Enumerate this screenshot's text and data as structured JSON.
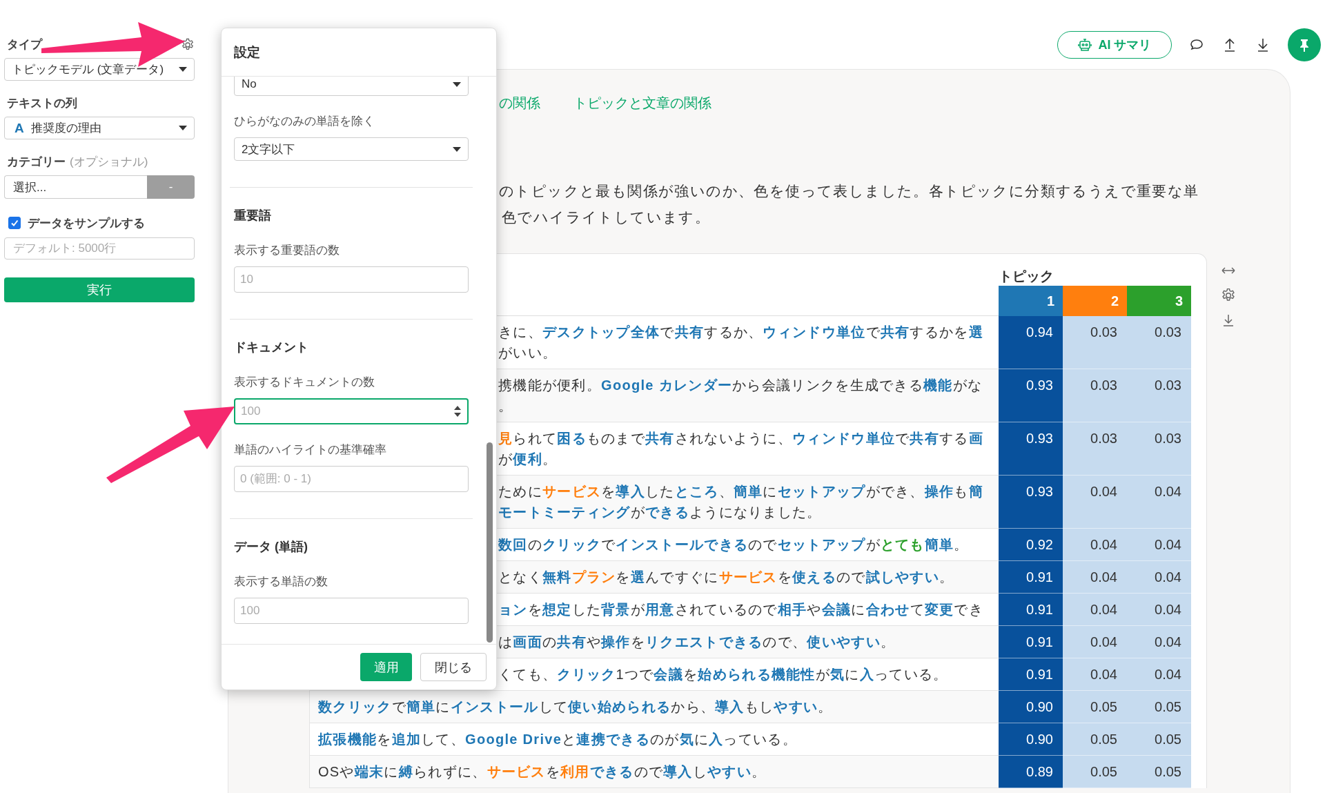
{
  "sidebar": {
    "type_label": "タイプ",
    "type_value": "トピックモデル (文章データ)",
    "text_column_label": "テキストの列",
    "text_column_type": "A",
    "text_column_value": "推奨度の理由",
    "category_label": "カテゴリー",
    "category_optional": "(オプショナル)",
    "category_value": "選択...",
    "category_button": "-",
    "sample": {
      "label": "データをサンプルする",
      "checked": true
    },
    "sample_placeholder": "デフォルト: 5000行",
    "run_button": "実行"
  },
  "toolbar": {
    "ai_button": "AI サマリ"
  },
  "tabs": [
    {
      "label": "の関係"
    },
    {
      "label": "トピックと文章の関係"
    }
  ],
  "description": [
    "のトピックと最も関係が強いのか、色を使って表しました。各トピックに分類するうえで重要な単",
    "色でハイライトしています。"
  ],
  "table": {
    "heading": "トピック",
    "topics": [
      {
        "label": "1",
        "color": "#1f77b4"
      },
      {
        "label": "2",
        "color": "#ff7f0e"
      },
      {
        "label": "3",
        "color": "#2ca02c"
      }
    ],
    "rows": [
      {
        "covered": true,
        "lines": [
          [
            {
              "text": "きに、"
            },
            {
              "text": "デスクトップ全体",
              "color": "#1f77b4"
            },
            {
              "text": "で"
            },
            {
              "text": "共有",
              "color": "#1f77b4"
            },
            {
              "text": "するか、"
            },
            {
              "text": "ウィンドウ単位",
              "color": "#1f77b4"
            },
            {
              "text": "で"
            },
            {
              "text": "共有",
              "color": "#1f77b4"
            },
            {
              "text": "するかを"
            },
            {
              "text": "選",
              "color": "#1f77b4"
            }
          ],
          [
            {
              "text": "がいい。"
            }
          ]
        ],
        "scores": [
          "0.94",
          "0.03",
          "0.03"
        ]
      },
      {
        "covered": true,
        "lines": [
          [
            {
              "text": "携機能が便利。"
            },
            {
              "text": "Google カレンダー",
              "color": "#1f77b4"
            },
            {
              "text": "から会議リンクを生成できる"
            },
            {
              "text": "機能",
              "color": "#1f77b4"
            },
            {
              "text": "がな"
            }
          ],
          [
            {
              "text": "。"
            }
          ]
        ],
        "scores": [
          "0.93",
          "0.03",
          "0.03"
        ]
      },
      {
        "covered": true,
        "lines": [
          [
            {
              "text": "見",
              "color": "#ff7f0e"
            },
            {
              "text": "られて"
            },
            {
              "text": "困る",
              "color": "#1f77b4"
            },
            {
              "text": "ものまで"
            },
            {
              "text": "共有",
              "color": "#1f77b4"
            },
            {
              "text": "されないように、"
            },
            {
              "text": "ウィンドウ単位",
              "color": "#1f77b4"
            },
            {
              "text": "で"
            },
            {
              "text": "共有",
              "color": "#1f77b4"
            },
            {
              "text": "する"
            },
            {
              "text": "画",
              "color": "#1f77b4"
            }
          ],
          [
            {
              "text": "が"
            },
            {
              "text": "便利",
              "color": "#1f77b4"
            },
            {
              "text": "。"
            }
          ]
        ],
        "scores": [
          "0.93",
          "0.03",
          "0.03"
        ]
      },
      {
        "covered": true,
        "lines": [
          [
            {
              "text": "ために"
            },
            {
              "text": "サービス",
              "color": "#ff7f0e"
            },
            {
              "text": "を"
            },
            {
              "text": "導入",
              "color": "#1f77b4"
            },
            {
              "text": "した"
            },
            {
              "text": "ところ",
              "color": "#1f77b4"
            },
            {
              "text": "、"
            },
            {
              "text": "簡単",
              "color": "#1f77b4"
            },
            {
              "text": "に"
            },
            {
              "text": "セットアップ",
              "color": "#1f77b4"
            },
            {
              "text": "ができ、"
            },
            {
              "text": "操作",
              "color": "#1f77b4"
            },
            {
              "text": "も"
            },
            {
              "text": "簡",
              "color": "#1f77b4"
            }
          ],
          [
            {
              "text": "モートミーティング",
              "color": "#1f77b4"
            },
            {
              "text": "が"
            },
            {
              "text": "できる",
              "color": "#1f77b4"
            },
            {
              "text": "ようになりました。"
            }
          ]
        ],
        "scores": [
          "0.93",
          "0.04",
          "0.04"
        ]
      },
      {
        "covered": true,
        "lines": [
          [
            {
              "text": "数回",
              "color": "#1f77b4"
            },
            {
              "text": "の"
            },
            {
              "text": "クリック",
              "color": "#1f77b4"
            },
            {
              "text": "で"
            },
            {
              "text": "インストールできる",
              "color": "#1f77b4"
            },
            {
              "text": "ので"
            },
            {
              "text": "セットアップ",
              "color": "#1f77b4"
            },
            {
              "text": "が"
            },
            {
              "text": "とても",
              "color": "#2ca02c"
            },
            {
              "text": "簡単",
              "color": "#1f77b4"
            },
            {
              "text": "。"
            }
          ]
        ],
        "scores": [
          "0.92",
          "0.04",
          "0.04"
        ]
      },
      {
        "covered": true,
        "lines": [
          [
            {
              "text": "となく"
            },
            {
              "text": "無料",
              "color": "#1f77b4"
            },
            {
              "text": "プラン",
              "color": "#ff7f0e"
            },
            {
              "text": "を"
            },
            {
              "text": "選",
              "color": "#1f77b4"
            },
            {
              "text": "んですぐに"
            },
            {
              "text": "サービス",
              "color": "#ff7f0e"
            },
            {
              "text": "を"
            },
            {
              "text": "使える",
              "color": "#1f77b4"
            },
            {
              "text": "ので"
            },
            {
              "text": "試しやすい",
              "color": "#1f77b4"
            },
            {
              "text": "。"
            }
          ]
        ],
        "scores": [
          "0.91",
          "0.04",
          "0.04"
        ]
      },
      {
        "covered": true,
        "lines": [
          [
            {
              "text": "ョン",
              "color": "#1f77b4"
            },
            {
              "text": "を"
            },
            {
              "text": "想定",
              "color": "#1f77b4"
            },
            {
              "text": "した"
            },
            {
              "text": "背景",
              "color": "#1f77b4"
            },
            {
              "text": "が"
            },
            {
              "text": "用意",
              "color": "#1f77b4"
            },
            {
              "text": "されているので"
            },
            {
              "text": "相手",
              "color": "#1f77b4"
            },
            {
              "text": "や"
            },
            {
              "text": "会議",
              "color": "#1f77b4"
            },
            {
              "text": "に"
            },
            {
              "text": "合わせ",
              "color": "#1f77b4"
            },
            {
              "text": "て"
            },
            {
              "text": "変更",
              "color": "#1f77b4"
            },
            {
              "text": "でき"
            }
          ]
        ],
        "scores": [
          "0.91",
          "0.04",
          "0.04"
        ]
      },
      {
        "covered": true,
        "lines": [
          [
            {
              "text": "は"
            },
            {
              "text": "画面",
              "color": "#1f77b4"
            },
            {
              "text": "の"
            },
            {
              "text": "共有",
              "color": "#1f77b4"
            },
            {
              "text": "や"
            },
            {
              "text": "操作",
              "color": "#1f77b4"
            },
            {
              "text": "を"
            },
            {
              "text": "リクエストできる",
              "color": "#1f77b4"
            },
            {
              "text": "ので、"
            },
            {
              "text": "使いやすい",
              "color": "#1f77b4"
            },
            {
              "text": "。"
            }
          ]
        ],
        "scores": [
          "0.91",
          "0.04",
          "0.04"
        ]
      },
      {
        "covered": true,
        "lines": [
          [
            {
              "text": "くても、"
            },
            {
              "text": "クリック",
              "color": "#1f77b4"
            },
            {
              "text": "1つで"
            },
            {
              "text": "会議",
              "color": "#1f77b4"
            },
            {
              "text": "を"
            },
            {
              "text": "始められる機能性",
              "color": "#1f77b4"
            },
            {
              "text": "が"
            },
            {
              "text": "気",
              "color": "#1f77b4"
            },
            {
              "text": "に"
            },
            {
              "text": "入",
              "color": "#1f77b4"
            },
            {
              "text": "っている。"
            }
          ]
        ],
        "scores": [
          "0.91",
          "0.04",
          "0.04"
        ]
      },
      {
        "covered": false,
        "lines": [
          [
            {
              "text": "数クリック",
              "color": "#1f77b4"
            },
            {
              "text": "で"
            },
            {
              "text": "簡単",
              "color": "#1f77b4"
            },
            {
              "text": "に"
            },
            {
              "text": "インストール",
              "color": "#1f77b4"
            },
            {
              "text": "して"
            },
            {
              "text": "使い始められる",
              "color": "#1f77b4"
            },
            {
              "text": "から、"
            },
            {
              "text": "導入",
              "color": "#1f77b4"
            },
            {
              "text": "もし"
            },
            {
              "text": "やすい",
              "color": "#1f77b4"
            },
            {
              "text": "。"
            }
          ]
        ],
        "scores": [
          "0.90",
          "0.05",
          "0.05"
        ]
      },
      {
        "covered": false,
        "lines": [
          [
            {
              "text": "拡張機能",
              "color": "#1f77b4"
            },
            {
              "text": "を"
            },
            {
              "text": "追加",
              "color": "#1f77b4"
            },
            {
              "text": "して、"
            },
            {
              "text": "Google Drive",
              "color": "#1f77b4"
            },
            {
              "text": "と"
            },
            {
              "text": "連携できる",
              "color": "#1f77b4"
            },
            {
              "text": "のが"
            },
            {
              "text": "気",
              "color": "#1f77b4"
            },
            {
              "text": "に"
            },
            {
              "text": "入",
              "color": "#1f77b4"
            },
            {
              "text": "っている。"
            }
          ]
        ],
        "scores": [
          "0.90",
          "0.05",
          "0.05"
        ]
      },
      {
        "covered": false,
        "lines": [
          [
            {
              "text": "OSや"
            },
            {
              "text": "端末",
              "color": "#1f77b4"
            },
            {
              "text": "に"
            },
            {
              "text": "縛",
              "color": "#1f77b4"
            },
            {
              "text": "られずに、"
            },
            {
              "text": "サービス",
              "color": "#ff7f0e"
            },
            {
              "text": "を"
            },
            {
              "text": "利用",
              "color": "#ff7f0e"
            },
            {
              "text": "できる",
              "color": "#1f77b4"
            },
            {
              "text": "ので"
            },
            {
              "text": "導入",
              "color": "#1f77b4"
            },
            {
              "text": "し"
            },
            {
              "text": "やすい",
              "color": "#1f77b4"
            },
            {
              "text": "。"
            }
          ]
        ],
        "scores": [
          "0.89",
          "0.05",
          "0.05"
        ]
      }
    ]
  },
  "dialog": {
    "title": "設定",
    "fields": [
      {
        "kind": "select",
        "value": "No"
      },
      {
        "kind": "select",
        "label": "ひらがなのみの単語を除く",
        "value": "2文字以下"
      },
      {
        "kind": "section",
        "title": "重要語"
      },
      {
        "kind": "input",
        "label": "表示する重要語の数",
        "placeholder": "10",
        "focused": false
      },
      {
        "kind": "section",
        "title": "ドキュメント"
      },
      {
        "kind": "number",
        "label": "表示するドキュメントの数",
        "placeholder": "100",
        "focused": true
      },
      {
        "kind": "input",
        "label": "単語のハイライトの基準確率",
        "placeholder": "0 (範囲: 0 - 1)",
        "focused": false
      },
      {
        "kind": "section",
        "title": "データ (単語)"
      },
      {
        "kind": "input",
        "label": "表示する単語の数",
        "placeholder": "100",
        "focused": false
      }
    ],
    "buttons": [
      {
        "label": "適用",
        "kind": "primary"
      },
      {
        "label": "閉じる",
        "kind": "default"
      }
    ]
  }
}
